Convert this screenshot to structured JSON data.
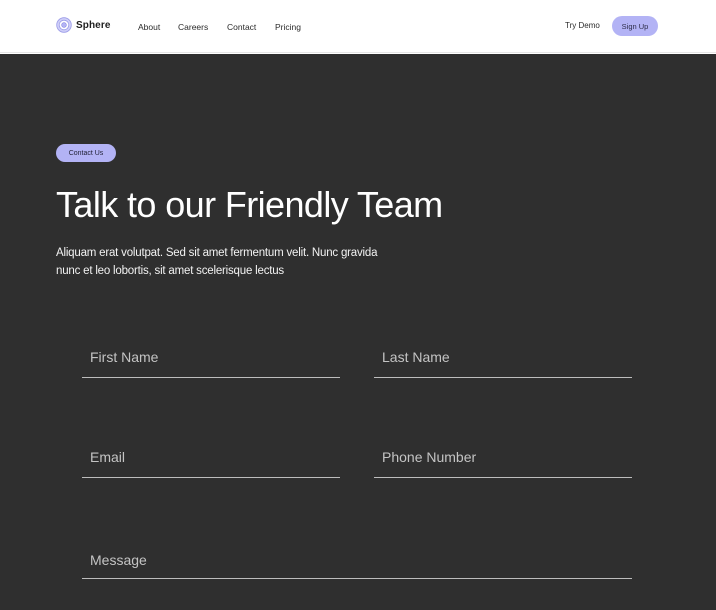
{
  "brand": {
    "name": "Sphere",
    "accent_color": "#b3b3f5",
    "logo_icon": "concentric-circle-icon"
  },
  "nav": {
    "items": [
      {
        "label": "About"
      },
      {
        "label": "Careers"
      },
      {
        "label": "Contact"
      },
      {
        "label": "Pricing"
      }
    ],
    "try_demo_label": "Try Demo",
    "signup_label": "Sign Up"
  },
  "hero": {
    "badge": "Contact Us",
    "title": "Talk to our Friendly Team",
    "description": "Aliquam erat volutpat. Sed sit amet fermentum velit. Nunc gravida nunc et leo lobortis, sit amet scelerisque lectus",
    "background_color": "#2f2f2f"
  },
  "form": {
    "first_name_placeholder": "First Name",
    "last_name_placeholder": "Last Name",
    "email_placeholder": "Email",
    "phone_placeholder": "Phone Number",
    "message_placeholder": "Message"
  }
}
